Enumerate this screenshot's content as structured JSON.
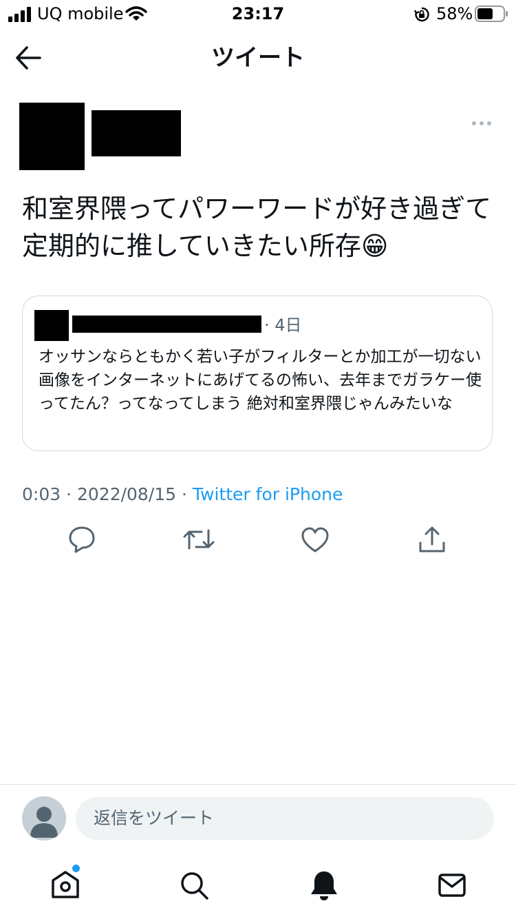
{
  "status_bar": {
    "carrier": "UQ mobile",
    "time": "23:17",
    "battery": "58%"
  },
  "header": {
    "title": "ツイート"
  },
  "tweet": {
    "text": "和室界隈ってパワーワードが好き過ぎて定期的に推していきたい所存😁",
    "timestamp": "0:03 · 2022/08/15 · ",
    "source": "Twitter for iPhone"
  },
  "quoted_tweet": {
    "time_ago": "· 4日",
    "text": "オッサンならともかく若い子がフィルターとか加工が一切ない画像をインターネットにあげてるの怖い、去年までガラケー使ってたん？ってなってしまう 絶対和室界隈じゃんみたいな"
  },
  "reply": {
    "placeholder": "返信をツイート"
  },
  "colors": {
    "accent": "#1d9bf0",
    "text": "#0f1419",
    "secondary_text": "#536471",
    "border": "#cfd9de"
  },
  "icons": {
    "back": "arrow-left-icon",
    "more": "more-dots-icon",
    "reply": "reply-bubble-icon",
    "retweet": "retweet-icon",
    "like": "heart-icon",
    "share": "share-icon",
    "home": "home-icon",
    "search": "search-icon",
    "notifications": "bell-icon",
    "messages": "envelope-icon"
  }
}
